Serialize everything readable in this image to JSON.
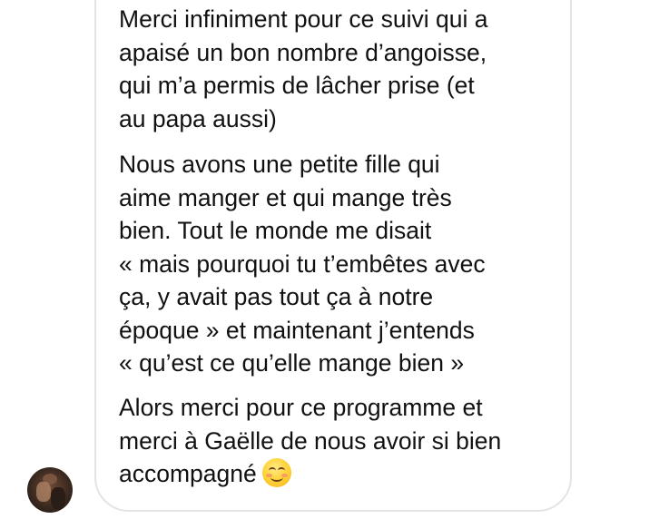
{
  "message": {
    "paragraphs": [
      {
        "lines": [
          "Merci infiniment pour ce suivi qui a",
          "apaisé un bon nombre d’angoisse,",
          "qui m’a permis de lâcher prise (et",
          "au papa aussi)"
        ]
      },
      {
        "lines": [
          "Nous avons une petite fille qui",
          "aime manger et qui mange très",
          "bien. Tout le monde me disait",
          "« mais pourquoi tu t’embêtes avec",
          "ça, y avait pas tout ça à notre",
          "époque » et maintenant j’entends",
          "« qu’est ce qu’elle mange bien »"
        ]
      },
      {
        "lines": [
          "Alors merci pour ce programme et",
          "merci à Gaëlle de nous avoir si bien",
          "accompagné"
        ]
      }
    ],
    "emoji": "smiling-face-emoji"
  },
  "colors": {
    "background": "#ffffff",
    "bubble_border": "#e4e4e6",
    "text": "#111111"
  }
}
